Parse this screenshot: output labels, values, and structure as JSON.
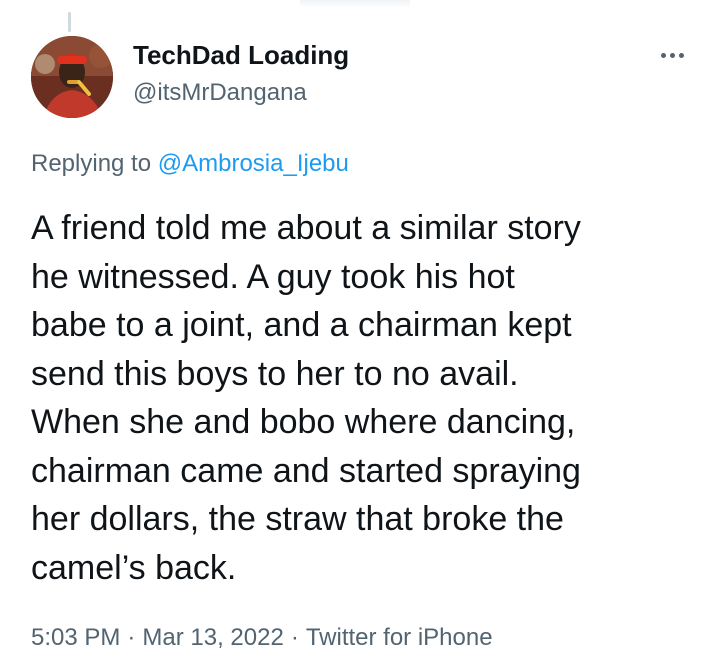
{
  "tweet": {
    "author": {
      "display_name": "TechDad Loading",
      "handle": "@itsMrDangana",
      "avatar": "avatar-photo"
    },
    "more_icon": "more-horizontal-icon",
    "replying_to": {
      "prefix": "Replying to",
      "mention": "@Ambrosia_Ijebu"
    },
    "text_lines": [
      "A friend told me about a similar story",
      "he witnessed. A guy took his hot",
      "babe to a joint, and a chairman kept",
      "send this boys to her to no avail.",
      "When she and bobo where dancing,",
      "chairman came and started spraying",
      "her dollars, the straw that broke the",
      "camel’s back."
    ],
    "time": "5:03 PM",
    "date": "Mar 13, 2022",
    "separator": "·",
    "source": "Twitter for iPhone"
  },
  "colors": {
    "text_primary": "#0f1419",
    "text_secondary": "#536471",
    "link": "#1d9bf0"
  }
}
